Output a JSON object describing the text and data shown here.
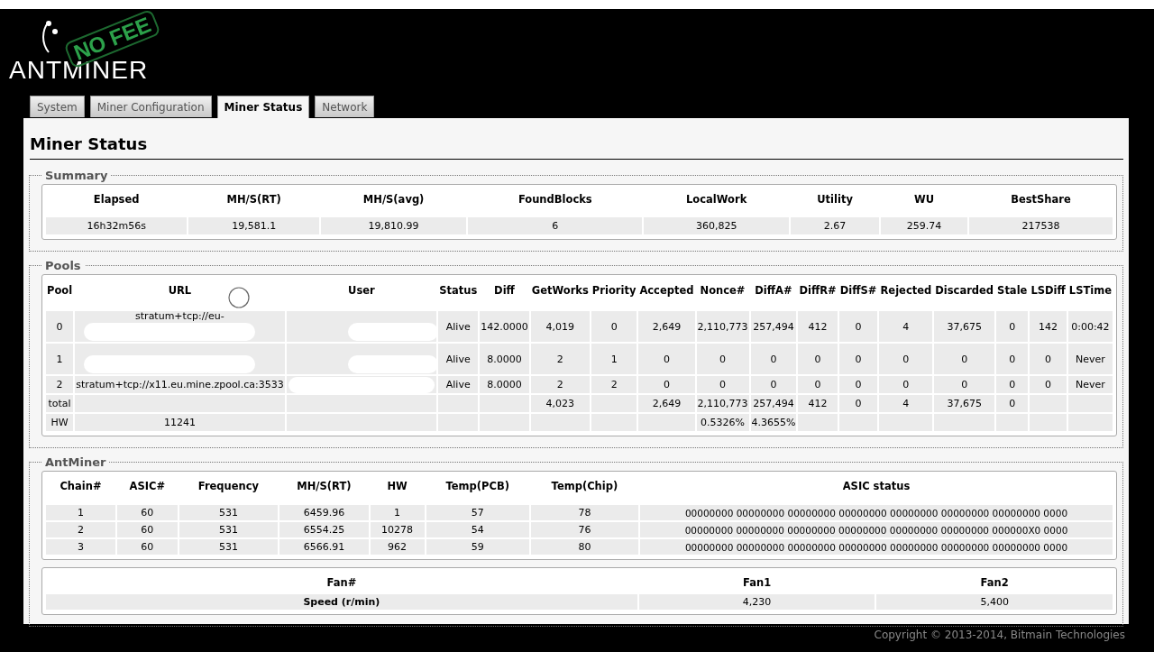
{
  "logo": {
    "text": "ANTMINER",
    "stamp": "NO FEE"
  },
  "tabs": [
    {
      "label": "System",
      "selected": false
    },
    {
      "label": "Miner Configuration",
      "selected": false
    },
    {
      "label": "Miner Status",
      "selected": true
    },
    {
      "label": "Network",
      "selected": false
    }
  ],
  "page_title": "Miner Status",
  "summary": {
    "legend": "Summary",
    "columns": [
      "Elapsed",
      "MH/S(RT)",
      "MH/S(avg)",
      "FoundBlocks",
      "LocalWork",
      "Utility",
      "WU",
      "BestShare"
    ],
    "row": [
      "16h32m56s",
      "19,581.1",
      "19,810.99",
      "6",
      "360,825",
      "2.67",
      "259.74",
      "217538"
    ]
  },
  "pools": {
    "legend": "Pools",
    "columns": [
      "Pool",
      "URL",
      "User",
      "Status",
      "Diff",
      "GetWorks",
      "Priority",
      "Accepted",
      "Nonce#",
      "DiffA#",
      "DiffR#",
      "DiffS#",
      "Rejected",
      "Discarded",
      "Stale",
      "LSDiff",
      "LSTime"
    ],
    "rows": [
      {
        "redacted_url": true,
        "redacted_user": true,
        "cells": [
          "0",
          "stratum+tcp://eu-",
          null,
          "Alive",
          "142.0000",
          "4,019",
          "0",
          "2,649",
          "2,110,773",
          "257,494",
          "412",
          "0",
          "4",
          "37,675",
          "0",
          "142",
          "0:00:42"
        ]
      },
      {
        "redacted_url": true,
        "redacted_user": true,
        "cells": [
          "1",
          null,
          null,
          "Alive",
          "8.0000",
          "2",
          "1",
          "0",
          "0",
          "0",
          "0",
          "0",
          "0",
          "0",
          "0",
          "0",
          "Never"
        ]
      },
      {
        "redacted_url": false,
        "redacted_user": true,
        "cells": [
          "2",
          "stratum+tcp://x11.eu.mine.zpool.ca:3533",
          null,
          "Alive",
          "8.0000",
          "2",
          "2",
          "0",
          "0",
          "0",
          "0",
          "0",
          "0",
          "0",
          "0",
          "0",
          "Never"
        ]
      },
      {
        "redacted_url": false,
        "redacted_user": false,
        "cells": [
          "total",
          null,
          null,
          null,
          null,
          "4,023",
          null,
          "2,649",
          "2,110,773",
          "257,494",
          "412",
          "0",
          "4",
          "37,675",
          "0",
          null,
          null
        ]
      },
      {
        "redacted_url": false,
        "redacted_user": false,
        "cells": [
          "HW",
          "11241",
          null,
          null,
          null,
          null,
          null,
          null,
          "0.5326%",
          "4.3655%",
          null,
          null,
          null,
          null,
          null,
          null,
          null
        ]
      }
    ]
  },
  "antminer": {
    "legend": "AntMiner",
    "columns": [
      "Chain#",
      "ASIC#",
      "Frequency",
      "MH/S(RT)",
      "HW",
      "Temp(PCB)",
      "Temp(Chip)",
      "ASIC status"
    ],
    "rows": [
      [
        "1",
        "60",
        "531",
        "6459.96",
        "1",
        "57",
        "78",
        "00000000 00000000 00000000 00000000 00000000 00000000 00000000 0000"
      ],
      [
        "2",
        "60",
        "531",
        "6554.25",
        "10278",
        "54",
        "76",
        "00000000 00000000 00000000 00000000 00000000 00000000 000000X0 0000"
      ],
      [
        "3",
        "60",
        "531",
        "6566.91",
        "962",
        "59",
        "80",
        "00000000 00000000 00000000 00000000 00000000 00000000 00000000 0000"
      ]
    ],
    "fans": {
      "columns": [
        "Fan#",
        "Fan1",
        "Fan2"
      ],
      "row": [
        "Speed (r/min)",
        "4,230",
        "5,400"
      ]
    }
  },
  "footer": "Copyright © 2013-2014, Bitmain Technologies"
}
